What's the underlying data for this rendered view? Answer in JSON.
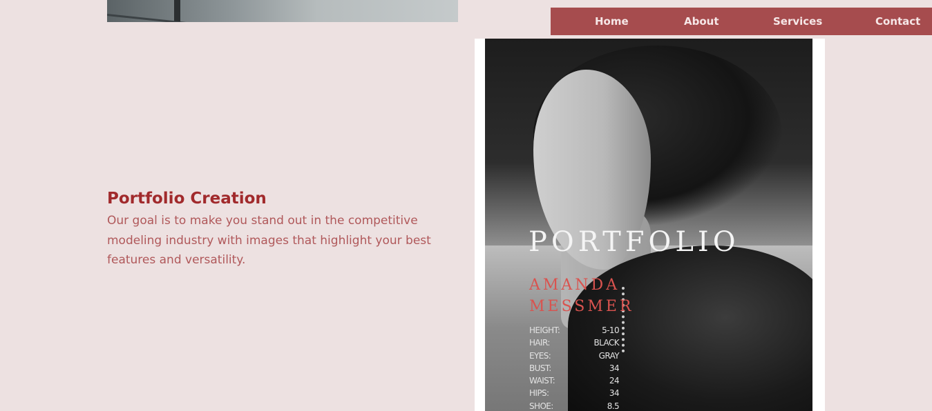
{
  "nav": {
    "items": [
      {
        "label": "Home"
      },
      {
        "label": "About"
      },
      {
        "label": "Services"
      },
      {
        "label": "Contact"
      }
    ]
  },
  "service": {
    "title": "Portfolio Creation",
    "description": "Our goal is to make you stand out in the competitive modeling industry with images that highlight your best features and versatility."
  },
  "portfolio_card": {
    "cover_title": "PORTFOLIO",
    "model_first_name": "AMANDA",
    "model_last_name": "MESSMER",
    "stats": [
      {
        "label": "HEIGHT:",
        "value": "5-10"
      },
      {
        "label": "HAIR:",
        "value": "BLACK"
      },
      {
        "label": "EYES:",
        "value": "GRAY"
      },
      {
        "label": "BUST:",
        "value": "34"
      },
      {
        "label": "WAIST:",
        "value": "24"
      },
      {
        "label": "HIPS:",
        "value": "34"
      },
      {
        "label": "SHOE:",
        "value": "8.5"
      }
    ]
  },
  "colors": {
    "background": "#ede1e1",
    "nav_bar": "#a64c4e",
    "nav_text": "#f6e7e7",
    "title": "#a12a2c",
    "body_text": "#b0585a",
    "accent_name": "#d9534f"
  }
}
